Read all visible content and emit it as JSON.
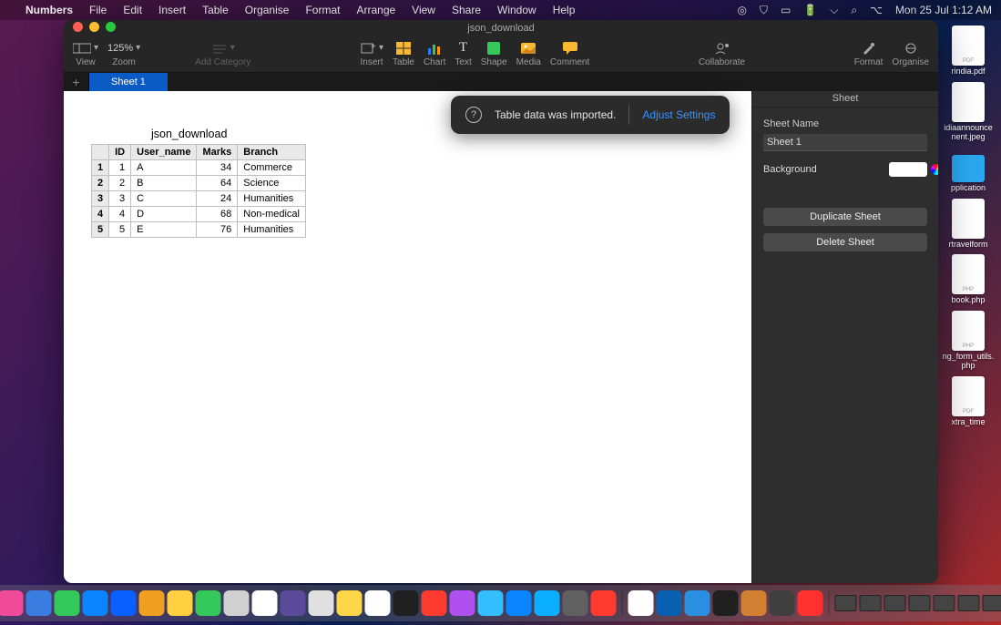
{
  "menubar": {
    "app": "Numbers",
    "items": [
      "File",
      "Edit",
      "Insert",
      "Table",
      "Organise",
      "Format",
      "Arrange",
      "View",
      "Share",
      "Window",
      "Help"
    ],
    "clock": "Mon 25 Jul  1:12 AM"
  },
  "window": {
    "title": "json_download",
    "toolbar": {
      "view": "View",
      "zoom": "Zoom",
      "zoom_val": "125%",
      "add_category": "Add Category",
      "insert": "Insert",
      "table": "Table",
      "chart": "Chart",
      "text": "Text",
      "shape": "Shape",
      "media": "Media",
      "comment": "Comment",
      "collaborate": "Collaborate",
      "format": "Format",
      "organise": "Organise"
    },
    "sheet_tab": "Sheet 1"
  },
  "canvas": {
    "title": "json_download"
  },
  "table": {
    "headers": [
      "ID",
      "User_name",
      "Marks",
      "Branch"
    ],
    "rows": [
      {
        "n": "1",
        "id": "1",
        "user": "A",
        "marks": "34",
        "branch": "Commerce"
      },
      {
        "n": "2",
        "id": "2",
        "user": "B",
        "marks": "64",
        "branch": "Science"
      },
      {
        "n": "3",
        "id": "3",
        "user": "C",
        "marks": "24",
        "branch": "Humanities"
      },
      {
        "n": "4",
        "id": "4",
        "user": "D",
        "marks": "68",
        "branch": "Non-medical"
      },
      {
        "n": "5",
        "id": "5",
        "user": "E",
        "marks": "76",
        "branch": "Humanities"
      }
    ]
  },
  "toast": {
    "message": "Table data was imported.",
    "action": "Adjust Settings"
  },
  "inspector": {
    "tab": "Sheet",
    "name_label": "Sheet Name",
    "name_value": "Sheet 1",
    "bg_label": "Background",
    "duplicate": "Duplicate Sheet",
    "delete": "Delete Sheet"
  },
  "desktop": [
    {
      "label": "rindia.pdf",
      "ext": "PDF"
    },
    {
      "label": "idiaannouncenent.jpeg",
      "ext": ""
    },
    {
      "label": "pplication",
      "ext": "",
      "folder": true
    },
    {
      "label": "rtravelform",
      "ext": ""
    },
    {
      "label": "book.php",
      "ext": "PHP"
    },
    {
      "label": "ng_form_utils.php",
      "ext": "PHP"
    },
    {
      "label": "xtra_time",
      "ext": "PDF"
    }
  ],
  "dock_colors": [
    "#2aa7f0",
    "#f04a9a",
    "#3a7de0",
    "#34c759",
    "#0a84ff",
    "#0a60ff",
    "#f0a020",
    "#ffd040",
    "#34c759",
    "#d0d0d0",
    "#ffffff",
    "#5b4a9a",
    "#e0e0e0",
    "#ffd54a",
    "#ffffff",
    "#202020",
    "#ff3b30",
    "#b050f0",
    "#32beff",
    "#0a84ff",
    "#0ab0ff",
    "#606060",
    "#ff3b30",
    "#ffffff",
    "#0a60b0",
    "#2a8fe0",
    "#202020",
    "#d08030",
    "#404040",
    "#ff3030"
  ]
}
